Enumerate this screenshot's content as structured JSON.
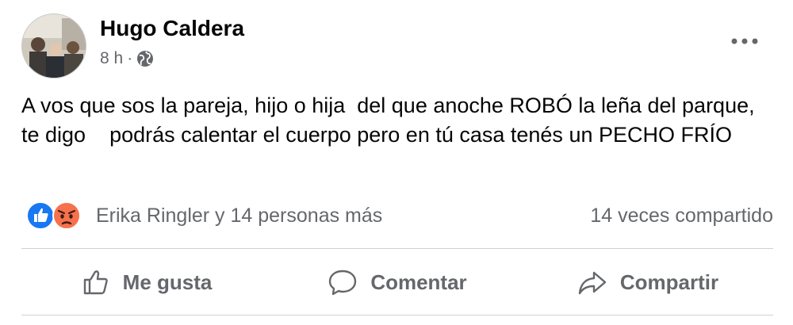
{
  "post": {
    "author": "Hugo Caldera",
    "time": "8 h",
    "separator": "·",
    "privacy_icon": "globe-icon",
    "more_icon": "more-options-icon",
    "text": "A vos que sos la pareja, hijo o hija  del que anoche ROBÓ la leña del parque,  te digo    podrás calentar el cuerpo pero en tú casa tenés un PECHO FRÍO",
    "reaction_icons": [
      "like-reaction-icon",
      "angry-reaction-icon"
    ],
    "reactions_text": "Erika Ringler y 14 personas más",
    "shares_text": "14 veces compartido"
  },
  "actions": {
    "like": "Me gusta",
    "comment": "Comentar",
    "share": "Compartir"
  },
  "colors": {
    "text": "#050505",
    "secondary": "#65676b",
    "like_blue": "#1877f2",
    "angry_orange": "#f7714c",
    "divider": "#ced0d4"
  }
}
